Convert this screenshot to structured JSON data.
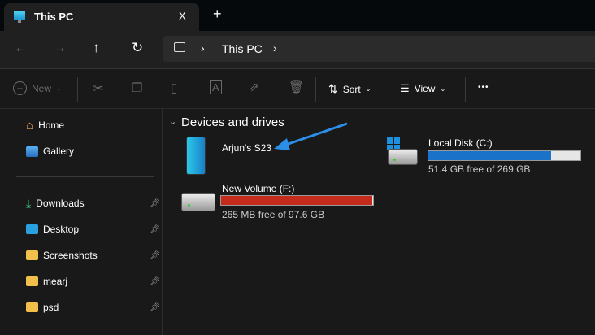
{
  "tab": {
    "title": "This PC",
    "close": "X",
    "new_tab": "+"
  },
  "address": {
    "crumbs": [
      "This PC"
    ]
  },
  "toolbar": {
    "new": "New",
    "sort": "Sort",
    "view": "View",
    "more": "•••"
  },
  "sidebar": {
    "items": [
      {
        "label": "Home",
        "icon": "home-icon",
        "pinned": false
      },
      {
        "label": "Gallery",
        "icon": "gallery-icon",
        "pinned": false
      },
      {
        "label": "Downloads",
        "icon": "download-icon",
        "pinned": true
      },
      {
        "label": "Desktop",
        "icon": "desktop-icon",
        "pinned": true
      },
      {
        "label": "Screenshots",
        "icon": "folder-icon",
        "pinned": true
      },
      {
        "label": "mearj",
        "icon": "folder-icon",
        "pinned": true
      },
      {
        "label": "psd",
        "icon": "folder-icon",
        "pinned": true
      }
    ]
  },
  "content": {
    "section": "Devices and drives",
    "devices": [
      {
        "name": "Arjun's S23",
        "icon": "phone-icon"
      },
      {
        "name": "Local Disk (C:)",
        "free": "51.4 GB free of 269 GB",
        "used_fraction": 0.81,
        "bar_color": "#1a73c9"
      },
      {
        "name": "New Volume (F:)",
        "free": "265 MB free of 97.6 GB",
        "used_fraction": 0.997,
        "bar_color": "#c42b1c"
      }
    ]
  },
  "annotation": {
    "arrow_color": "#2b8fe8"
  }
}
